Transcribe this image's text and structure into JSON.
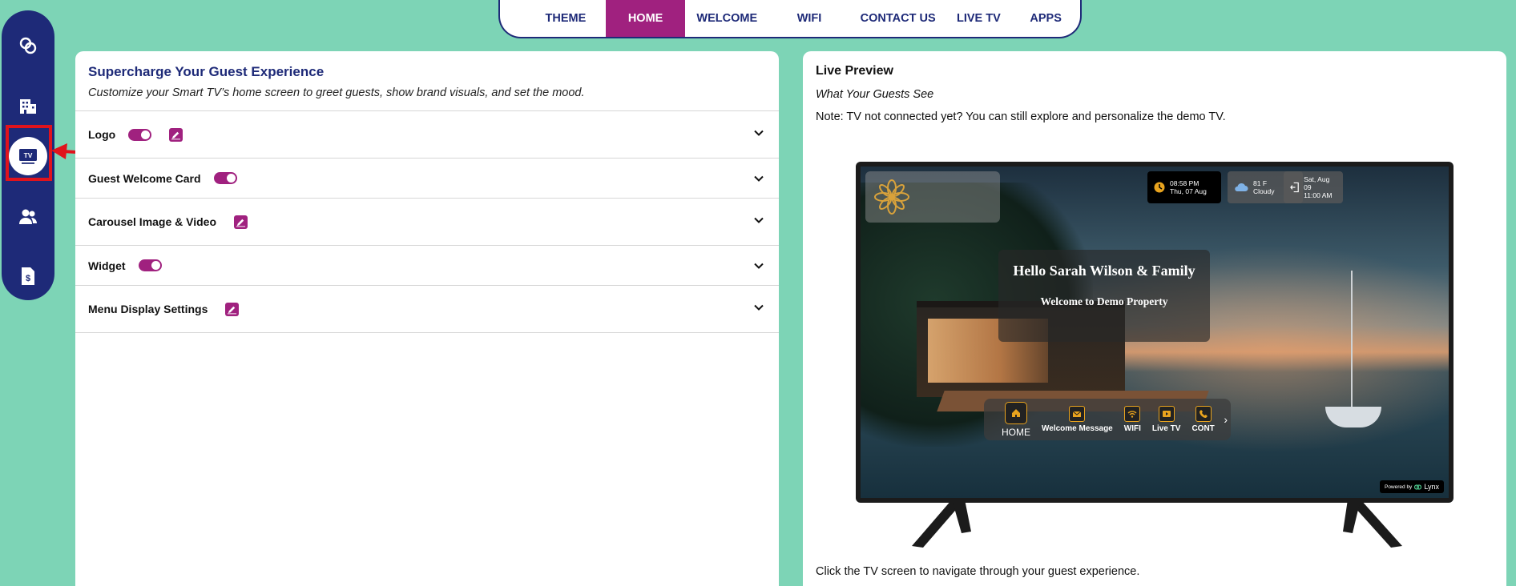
{
  "nav_rail": {
    "items": [
      {
        "name": "rings-icon"
      },
      {
        "name": "building-icon"
      },
      {
        "name": "tv-icon",
        "label": "TV",
        "active": true
      },
      {
        "name": "users-icon"
      },
      {
        "name": "invoice-icon"
      }
    ]
  },
  "tabs": [
    {
      "label": "THEME"
    },
    {
      "label": "HOME",
      "active": true
    },
    {
      "label": "WELCOME"
    },
    {
      "label": "WIFI"
    },
    {
      "label": "CONTACT US"
    },
    {
      "label": "LIVE TV"
    },
    {
      "label": "APPS"
    }
  ],
  "config": {
    "title": "Supercharge Your Guest Experience",
    "subtitle": "Customize your Smart TV’s home screen to greet guests, show brand visuals, and set the mood.",
    "rows": [
      {
        "label": "Logo",
        "toggle_on": true,
        "editable": true
      },
      {
        "label": "Guest Welcome Card",
        "toggle_on": true,
        "editable": false
      },
      {
        "label": "Carousel Image & Video",
        "toggle_on": null,
        "editable": true
      },
      {
        "label": "Widget",
        "toggle_on": true,
        "editable": false
      },
      {
        "label": "Menu Display Settings",
        "toggle_on": null,
        "editable": true
      }
    ]
  },
  "preview": {
    "title": "Live Preview",
    "subtitle": "What Your Guests See",
    "note": "Note: TV not connected yet? You can still explore and personalize the demo TV.",
    "footer": "Click the TV screen to navigate through your guest experience."
  },
  "tv": {
    "clock": {
      "time": "08:58 PM",
      "date": "Thu, 07 Aug"
    },
    "weather": {
      "temp": "81 F",
      "condition": "Cloudy"
    },
    "checkout": {
      "date": "Sat, Aug 09",
      "time": "11:00 AM"
    },
    "welcome_card": {
      "greeting": "Hello Sarah Wilson & Family",
      "message": "Welcome to Demo Property"
    },
    "menu": [
      {
        "label": "HOME",
        "icon": "home-icon"
      },
      {
        "label": "Welcome Message",
        "icon": "envelope-icon"
      },
      {
        "label": "WIFI",
        "icon": "wifi-icon"
      },
      {
        "label": "Live TV",
        "icon": "play-icon"
      },
      {
        "label": "CONT",
        "icon": "phone-icon"
      }
    ],
    "powered_by": "Powered by",
    "brand": "Lynx"
  },
  "colors": {
    "background": "#7dd4b6",
    "rail": "#1e2a78",
    "accent": "#a0217f",
    "highlight": "#e0131c",
    "tv_gold": "#e8a31e"
  }
}
